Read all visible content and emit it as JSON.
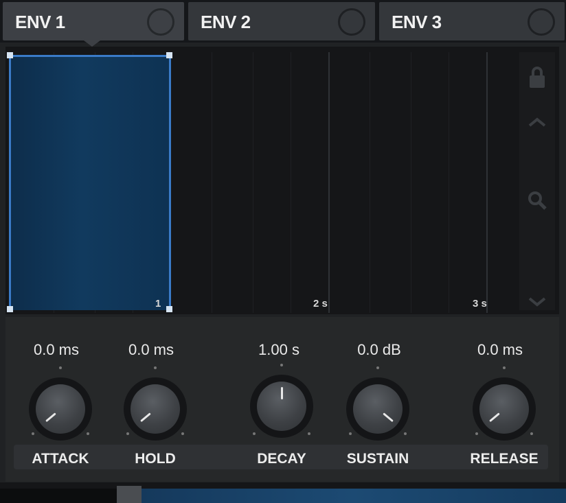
{
  "tabs": [
    {
      "label": "ENV 1",
      "active": true
    },
    {
      "label": "ENV 2",
      "active": false
    },
    {
      "label": "ENV 3",
      "active": false
    }
  ],
  "graph": {
    "time_labels": [
      "1",
      "2 s",
      "3 s"
    ],
    "side_icons": [
      "lock-icon",
      "chevron-up-icon",
      "zoom-icon",
      "chevron-down-icon"
    ],
    "fill_color": "#113a5e",
    "edge_color": "#3a7bc8"
  },
  "params": [
    {
      "label": "ATTACK",
      "value": "0.0 ms"
    },
    {
      "label": "HOLD",
      "value": "0.0 ms"
    },
    {
      "label": "DECAY",
      "value": "1.00 s"
    },
    {
      "label": "SUSTAIN",
      "value": "0.0 dB"
    },
    {
      "label": "RELEASE",
      "value": "0.0 ms"
    }
  ]
}
